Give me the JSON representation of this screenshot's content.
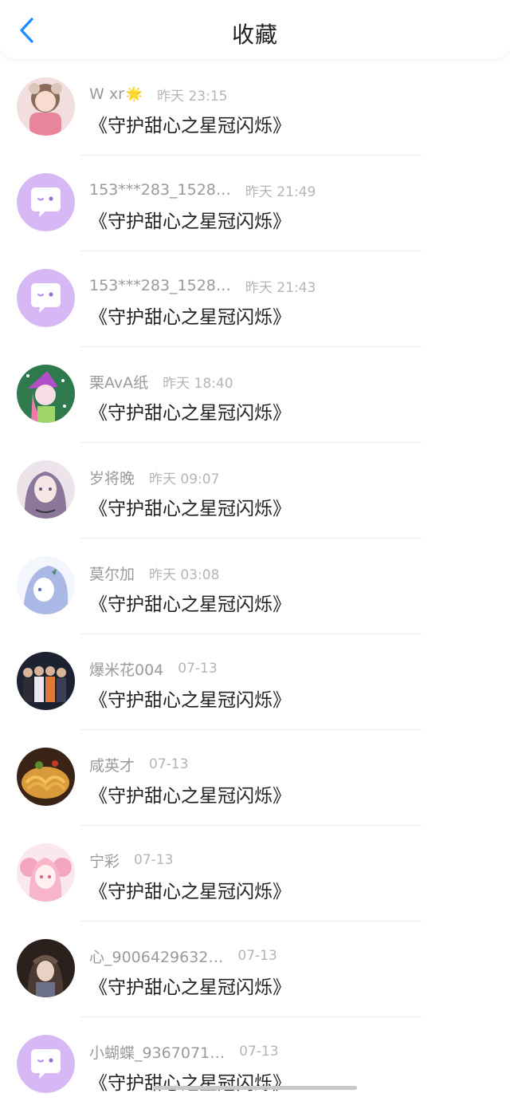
{
  "header": {
    "title": "收藏",
    "back_icon": "chevron-left-icon",
    "accent": "#1a8cff"
  },
  "items": [
    {
      "name": "W xr",
      "badge": "🌟",
      "time": "昨天 23:15",
      "content": "《守护甜心之星冠闪烁》",
      "avatar": "anime-girl-pink-avatar"
    },
    {
      "name": "153***283_1528…",
      "time": "昨天 21:49",
      "content": "《守护甜心之星冠闪烁》",
      "avatar": "default-chat-bubble-avatar"
    },
    {
      "name": "153***283_1528…",
      "time": "昨天 21:43",
      "content": "《守护甜心之星冠闪烁》",
      "avatar": "default-chat-bubble-avatar"
    },
    {
      "name": "栗AvA纸",
      "time": "昨天 18:40",
      "content": "《守护甜心之星冠闪烁》",
      "avatar": "anime-witch-avatar"
    },
    {
      "name": "岁将晚",
      "time": "昨天 09:07",
      "content": "《守护甜心之星冠闪烁》",
      "avatar": "purple-hair-girl-avatar"
    },
    {
      "name": "莫尔加",
      "time": "昨天 03:08",
      "content": "《守护甜心之星冠闪烁》",
      "avatar": "blue-sketch-girl-avatar"
    },
    {
      "name": "爆米花004",
      "time": "07-13",
      "content": "《守护甜心之星冠闪烁》",
      "avatar": "group-photo-avatar"
    },
    {
      "name": "咸英才",
      "time": "07-13",
      "content": "《守护甜心之星冠闪烁》",
      "avatar": "noodles-dish-avatar"
    },
    {
      "name": "宁彩",
      "time": "07-13",
      "content": "《守护甜心之星冠闪烁》",
      "avatar": "pink-twintails-girl-avatar"
    },
    {
      "name": "心_9006429632…",
      "time": "07-13",
      "content": "《守护甜心之星冠闪烁》",
      "avatar": "dark-photo-girl-avatar"
    },
    {
      "name": "小蝴蝶_9367071…",
      "time": "07-13",
      "content": "《守护甜心之星冠闪烁》",
      "avatar": "default-chat-bubble-avatar"
    }
  ]
}
